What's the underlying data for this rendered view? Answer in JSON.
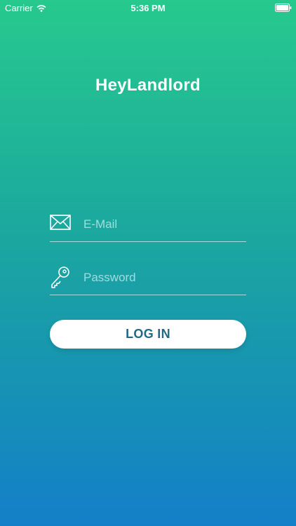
{
  "status_bar": {
    "carrier": "Carrier",
    "time": "5:36 PM",
    "wifi_icon": "wifi-icon",
    "battery_icon": "battery-icon"
  },
  "app": {
    "title": "HeyLandlord"
  },
  "form": {
    "email": {
      "icon": "envelope-icon",
      "placeholder": "E-Mail",
      "value": ""
    },
    "password": {
      "icon": "key-icon",
      "placeholder": "Password",
      "value": ""
    },
    "login_label": "LOG IN"
  },
  "colors": {
    "gradient_top": "#27c98e",
    "gradient_bottom": "#137fc9",
    "button_text": "#1f6a86",
    "button_background": "#ffffff"
  }
}
